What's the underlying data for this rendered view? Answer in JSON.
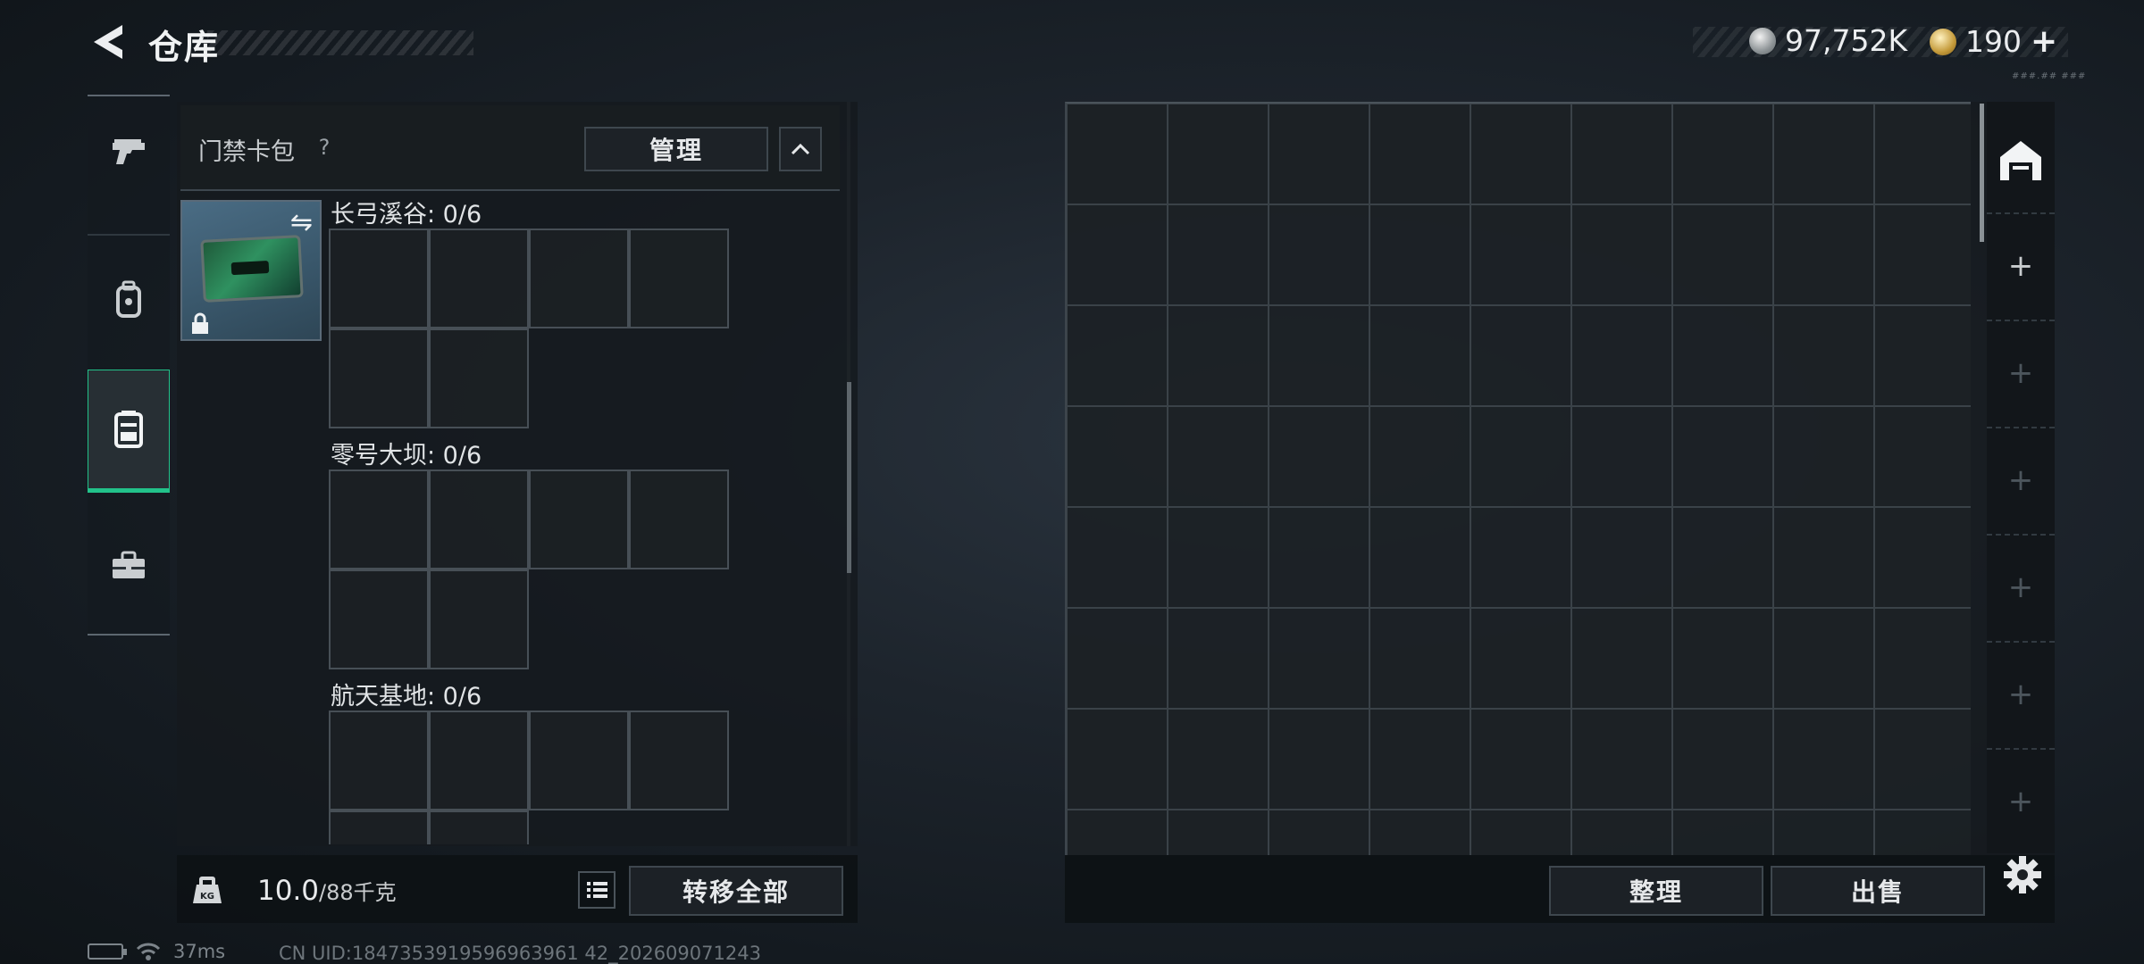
{
  "header": {
    "title": "仓库",
    "currency_primary": "97,752K",
    "currency_secondary": "190",
    "currency_add": "+",
    "small_text": "###.## ###"
  },
  "left_nav": {
    "items": [
      {
        "name": "weapons",
        "icon": "pistol-icon"
      },
      {
        "name": "gear",
        "icon": "backpack-icon"
      },
      {
        "name": "keycards",
        "icon": "keycard-case-icon",
        "active": true
      },
      {
        "name": "supplies",
        "icon": "toolbox-icon"
      }
    ]
  },
  "keycard_panel": {
    "title": "门禁卡包",
    "help": "?",
    "manage_label": "管理",
    "sections": [
      {
        "label": "长弓溪谷: 0/6"
      },
      {
        "label": "零号大坝: 0/6"
      },
      {
        "label": "航天基地: 0/6"
      }
    ]
  },
  "bottom_left": {
    "weight_current": "10.0",
    "weight_max": "/88千克",
    "transfer_all_label": "转移全部"
  },
  "bottom_right": {
    "arrange_label": "整理",
    "sell_label": "出售"
  },
  "right_tabs": {
    "items": [
      "+",
      "+",
      "+",
      "+",
      "+",
      "+"
    ]
  },
  "status": {
    "ping": "37ms",
    "uid": "CN UID:1847353919596963961 42_202609071243"
  },
  "colors": {
    "accent_green": "#22c28a",
    "panel_bg": "#151a1e",
    "border": "#474f56"
  }
}
